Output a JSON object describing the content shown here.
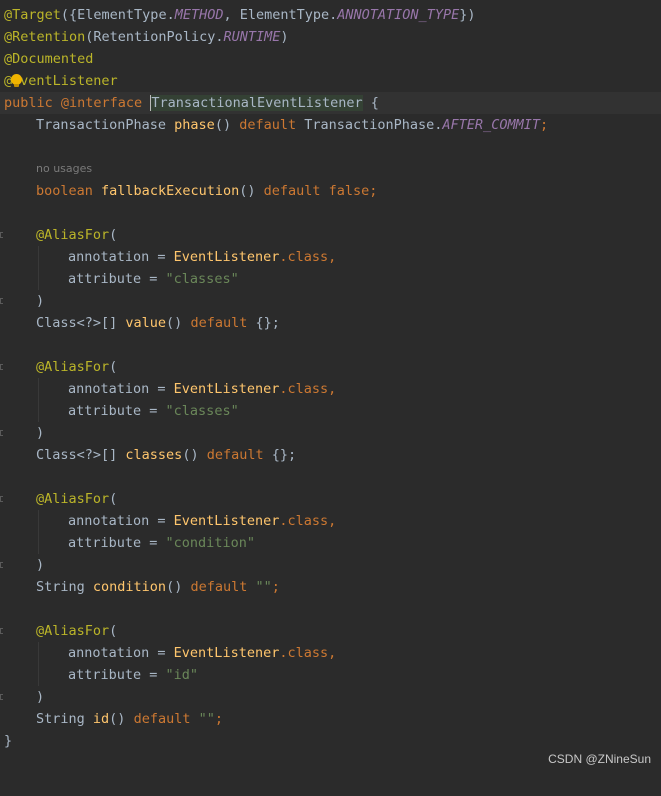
{
  "editor": {
    "hint_no_usages": "no usages",
    "lines": {
      "l1": [
        "@Target",
        "({ElementType.",
        "METHOD",
        ", ElementType.",
        "ANNOTATION_TYPE",
        "})"
      ],
      "l2": [
        "@Retention",
        "(RetentionPolicy.",
        "RUNTIME",
        ")"
      ],
      "l3": [
        "@Documented"
      ],
      "l4": [
        "@",
        "ventListener"
      ],
      "l5": [
        "public",
        " @interface ",
        "TransactionalEventListener",
        " {"
      ],
      "l6": [
        "TransactionPhase ",
        "phase",
        "() ",
        "default",
        " TransactionPhase.",
        "AFTER_COMMIT",
        ";"
      ],
      "l8": [
        "boolean",
        " ",
        "fallbackExecution",
        "() ",
        "default",
        " ",
        "false",
        ";"
      ],
      "alias": "@AliasFor",
      "open_paren": "(",
      "close_paren": ")",
      "annotation_key": "annotation = ",
      "annotation_val": "EventListener",
      "class_suffix": ".class",
      "comma": ",",
      "attribute_key": "attribute = ",
      "attr_classes": "\"classes\"",
      "attr_condition": "\"condition\"",
      "attr_id": "\"id\"",
      "value_decl": [
        "Class<?>[] ",
        "value",
        "() ",
        "default",
        " {};"
      ],
      "classes_decl": [
        "Class<?>[] ",
        "classes",
        "() ",
        "default",
        " {};"
      ],
      "condition_decl": [
        "String ",
        "condition",
        "() ",
        "default",
        " ",
        "\"\"",
        ";"
      ],
      "id_decl": [
        "String ",
        "id",
        "() ",
        "default",
        " ",
        "\"\"",
        ";"
      ],
      "closing_brace": "}"
    }
  },
  "watermark": "CSDN @ZNineSun",
  "colors": {
    "background": "#2b2b2b",
    "annotation": "#bbb529",
    "keyword": "#cc7832",
    "string": "#6a8759",
    "constant": "#9876aa",
    "method": "#ffc66d",
    "default_text": "#a9b7c6"
  }
}
